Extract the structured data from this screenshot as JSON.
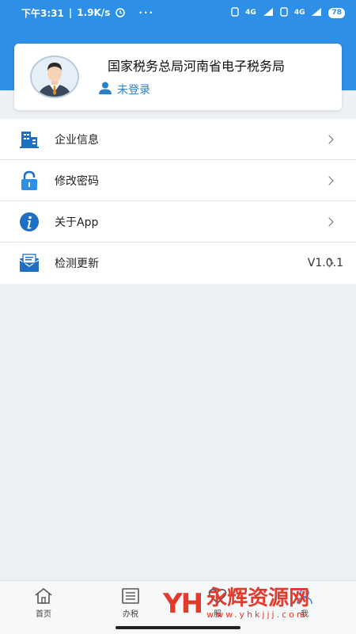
{
  "status_bar": {
    "time": "下午3:31",
    "speed": "1.9K/s",
    "more": "···",
    "net1": "4G",
    "net2": "4G",
    "battery": "78"
  },
  "profile": {
    "org_name": "国家税务总局河南省电子税务局",
    "login_status": "未登录"
  },
  "menu": [
    {
      "label": "企业信息",
      "icon": "building-icon",
      "value": ""
    },
    {
      "label": "修改密码",
      "icon": "lock-icon",
      "value": ""
    },
    {
      "label": "关于App",
      "icon": "info-icon",
      "value": ""
    },
    {
      "label": "检测更新",
      "icon": "mail-update-icon",
      "value": "V1.0.1"
    }
  ],
  "tabbar": [
    {
      "label": "首页",
      "icon": "home-icon"
    },
    {
      "label": "办税",
      "icon": "list-icon"
    },
    {
      "label": "服",
      "icon": "heart-icon"
    },
    {
      "label": "我",
      "icon": "user-icon"
    }
  ],
  "watermark": {
    "logo": "YH",
    "title": "永辉资源网",
    "url": "www.yhkjjj.com"
  },
  "colors": {
    "primary": "#2d8fe6",
    "icon_blue": "#1e6fc4",
    "link": "#2b7fc7",
    "watermark": "#e23a2c"
  }
}
